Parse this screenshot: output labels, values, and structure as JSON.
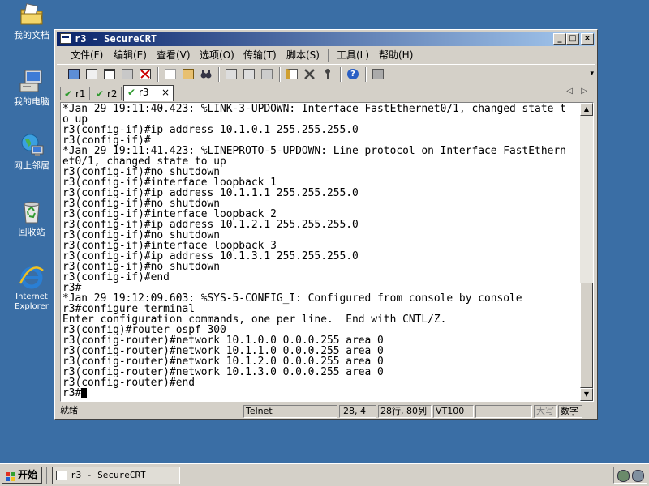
{
  "desktop": {
    "icons": [
      {
        "label": "我的文档",
        "icon": "my-documents-icon"
      },
      {
        "label": "我的电脑",
        "icon": "my-computer-icon"
      },
      {
        "label": "网上邻居",
        "icon": "network-places-icon"
      },
      {
        "label": "回收站",
        "icon": "recycle-bin-icon"
      },
      {
        "label1": "Internet",
        "label2": "Explorer",
        "icon": "internet-explorer-icon"
      }
    ]
  },
  "window": {
    "title": "r3 - SecureCRT",
    "controls": {
      "minimize": "_",
      "maximize": "□",
      "close": "×"
    }
  },
  "menu": {
    "items": [
      "文件(F)",
      "编辑(E)",
      "查看(V)",
      "选项(O)",
      "传输(T)",
      "脚本(S)",
      "工具(L)",
      "帮助(H)"
    ]
  },
  "tabs": [
    {
      "label": "r1",
      "active": false
    },
    {
      "label": "r2",
      "active": false
    },
    {
      "label": "r3",
      "active": true,
      "close": "×"
    }
  ],
  "tab_nav": {
    "prev": "◁",
    "next": "▷"
  },
  "terminal": {
    "text": "*Jan 29 19:11:40.423: %LINK-3-UPDOWN: Interface FastEthernet0/1, changed state t\no up\nr3(config-if)#ip address 10.1.0.1 255.255.255.0\nr3(config-if)#\n*Jan 29 19:11:41.423: %LINEPROTO-5-UPDOWN: Line protocol on Interface FastEthern\net0/1, changed state to up\nr3(config-if)#no shutdown\nr3(config-if)#interface loopback 1\nr3(config-if)#ip address 10.1.1.1 255.255.255.0\nr3(config-if)#no shutdown\nr3(config-if)#interface loopback 2\nr3(config-if)#ip address 10.1.2.1 255.255.255.0\nr3(config-if)#no shutdown\nr3(config-if)#interface loopback 3\nr3(config-if)#ip address 10.1.3.1 255.255.255.0\nr3(config-if)#no shutdown\nr3(config-if)#end\nr3#\n*Jan 29 19:12:09.603: %SYS-5-CONFIG_I: Configured from console by console\nr3#configure terminal\nEnter configuration commands, one per line.  End with CNTL/Z.\nr3(config)#router ospf 300\nr3(config-router)#network 10.1.0.0 0.0.0.255 area 0\nr3(config-router)#network 10.1.1.0 0.0.0.255 area 0\nr3(config-router)#network 10.1.2.0 0.0.0.255 area 0\nr3(config-router)#network 10.1.3.0 0.0.0.255 area 0\nr3(config-router)#end\n",
    "prompt": "r3#"
  },
  "statusbar": {
    "ready": "就绪",
    "protocol": "Telnet",
    "cursor_pos": "28,  4",
    "size": "28行, 80列",
    "emulation": "VT100",
    "caps": "大写",
    "num": "数字"
  },
  "taskbar": {
    "start": "开始",
    "task_title": "r3 - SecureCRT"
  },
  "colors": {
    "desktop": "#3a6ea5",
    "titlebar_start": "#0a246a",
    "titlebar_end": "#a6caf0",
    "chrome": "#d4d0c8",
    "tab_check": "#2f9a2f"
  }
}
